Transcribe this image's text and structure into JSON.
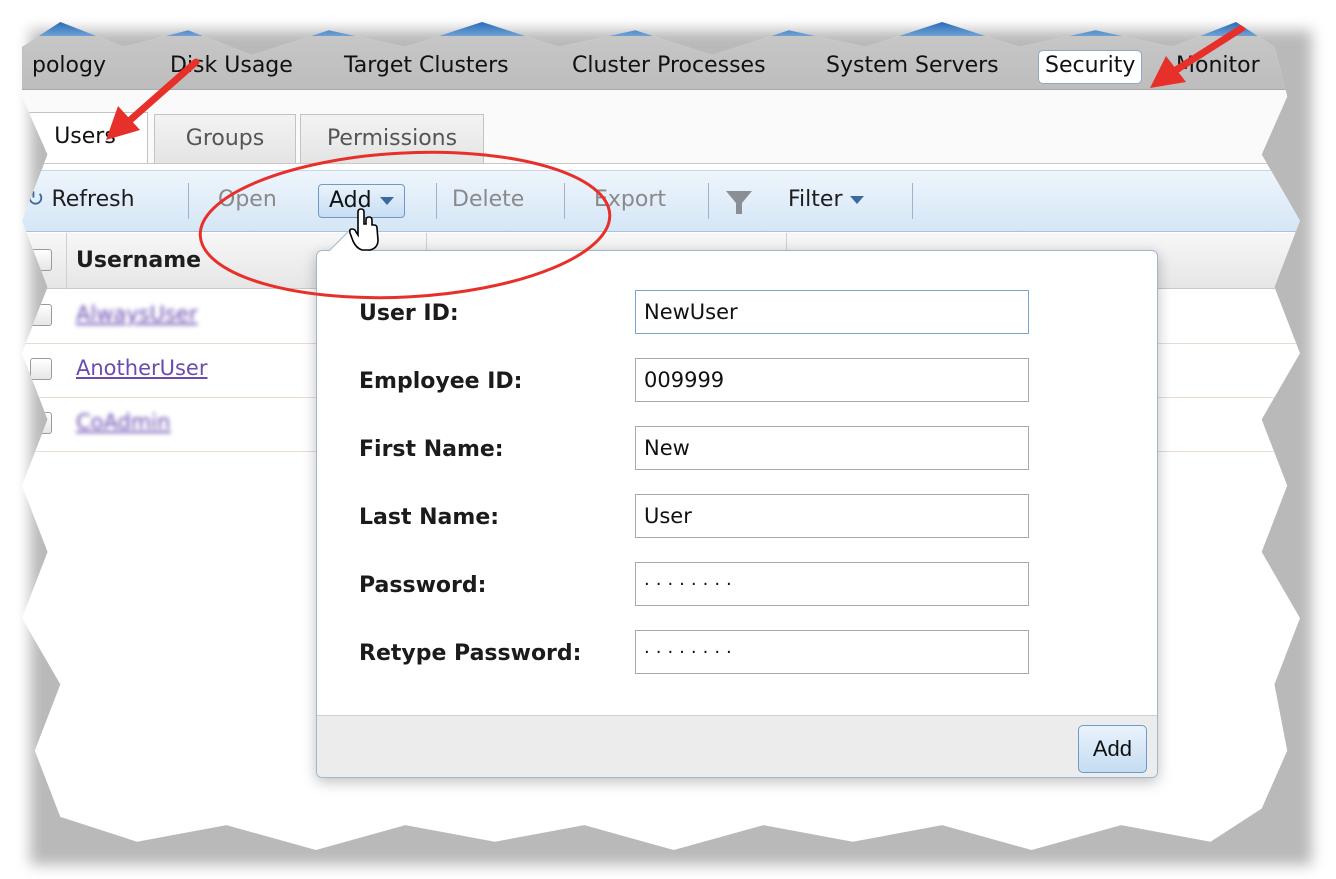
{
  "top_nav": {
    "items": [
      "pology",
      "Disk Usage",
      "Target Clusters",
      "Cluster Processes",
      "System Servers",
      "Security",
      "Monitor"
    ],
    "active": "Security"
  },
  "sub_tabs": {
    "items": [
      "Users",
      "Groups",
      "Permissions"
    ],
    "active": "Users"
  },
  "toolbar": {
    "refresh": "Refresh",
    "open": "Open",
    "add": "Add",
    "delete": "Delete",
    "export": "Export",
    "filter": "Filter",
    "filter_icon": "funnel-icon"
  },
  "grid": {
    "columns": [
      "Username"
    ],
    "rows": [
      "AlwaysUser",
      "AnotherUser",
      "CoAdmin"
    ]
  },
  "add_user_form": {
    "fields": [
      {
        "label": "User ID:",
        "value": "NewUser"
      },
      {
        "label": "Employee ID:",
        "value": "009999"
      },
      {
        "label": "First Name:",
        "value": "New"
      },
      {
        "label": "Last Name:",
        "value": "User"
      },
      {
        "label": "Password:",
        "value": "········"
      },
      {
        "label": "Retype Password:",
        "value": "········"
      }
    ],
    "submit_label": "Add"
  },
  "colors": {
    "annotation_red": "#e8302a",
    "toolbar_blue": "#d5e6f6",
    "link_purple": "#6a4bb0"
  }
}
